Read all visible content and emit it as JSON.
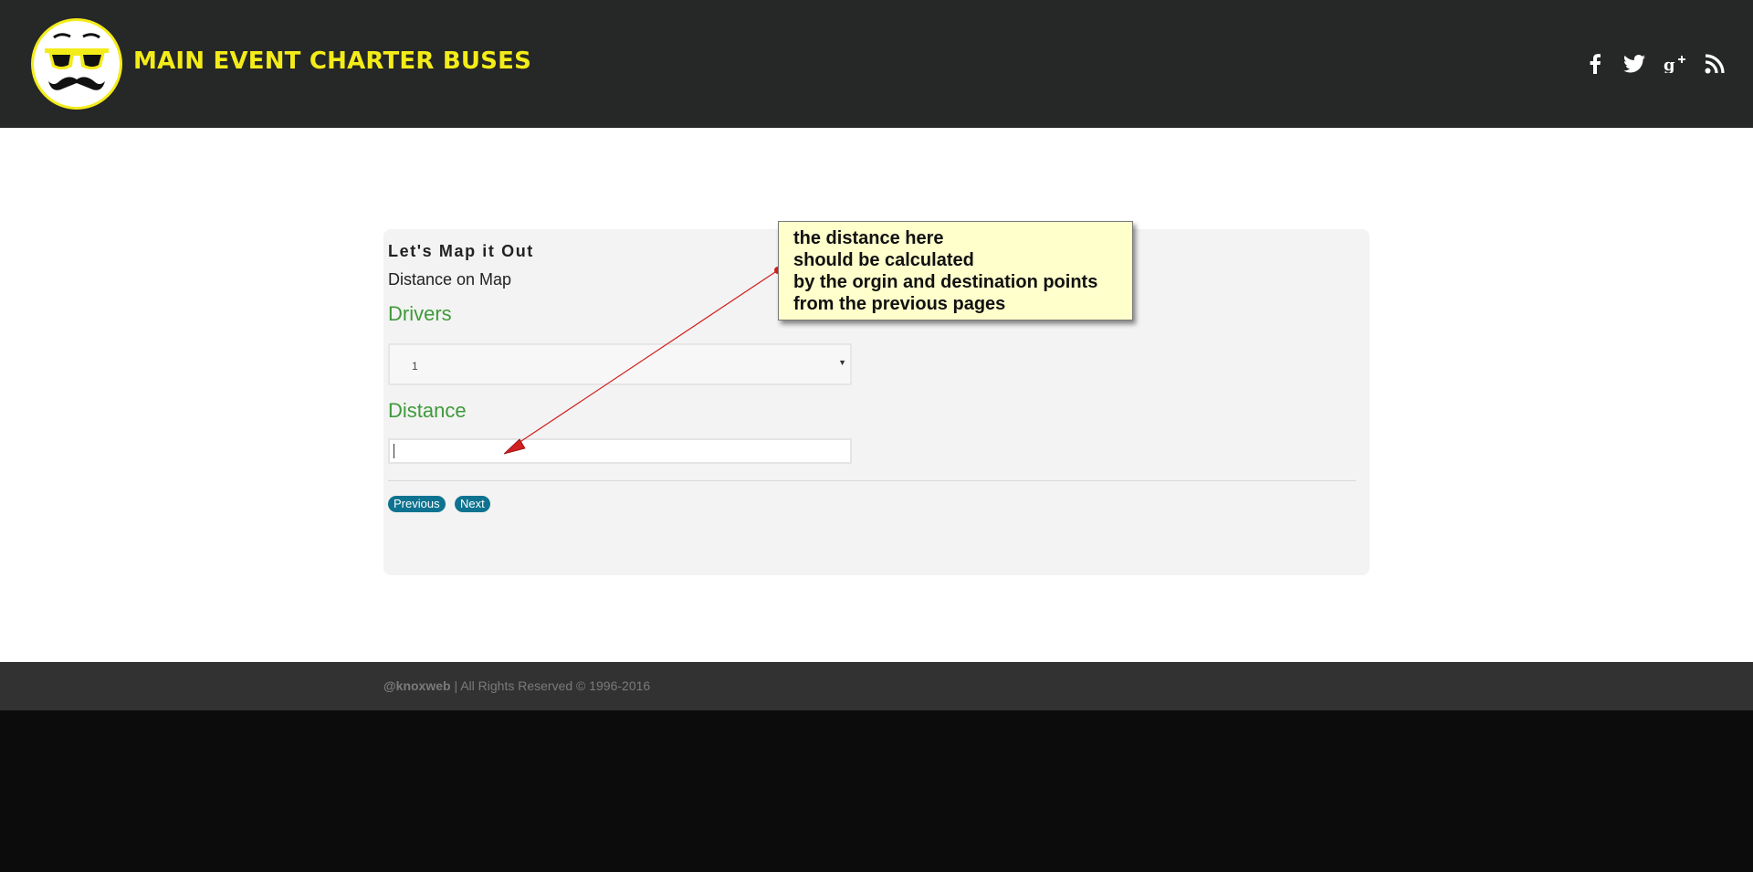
{
  "header": {
    "site_title": "MAIN EVENT CHARTER BUSES",
    "social": [
      "facebook-icon",
      "twitter-icon",
      "google-plus-icon",
      "rss-icon"
    ]
  },
  "form": {
    "heading": "Let's Map it Out",
    "subheading": "Distance on Map",
    "drivers_label": "Drivers",
    "drivers_value": "1",
    "distance_label": "Distance",
    "distance_value": "",
    "previous_label": "Previous",
    "next_label": "Next"
  },
  "annotation": {
    "lines": [
      "the distance here",
      "should be calculated",
      "by the orgin and destination points",
      "from the previous pages"
    ],
    "arrow_color": "#d21f1f"
  },
  "footer": {
    "brand": "@knoxweb",
    "rights": " | All Rights Reserved © 1996-2016"
  },
  "colors": {
    "brand_yellow": "#f4ec19",
    "header_bg": "#262727",
    "label_green": "#3f9a3a",
    "button_blue": "#0e7390",
    "note_bg": "#ffffcc"
  }
}
